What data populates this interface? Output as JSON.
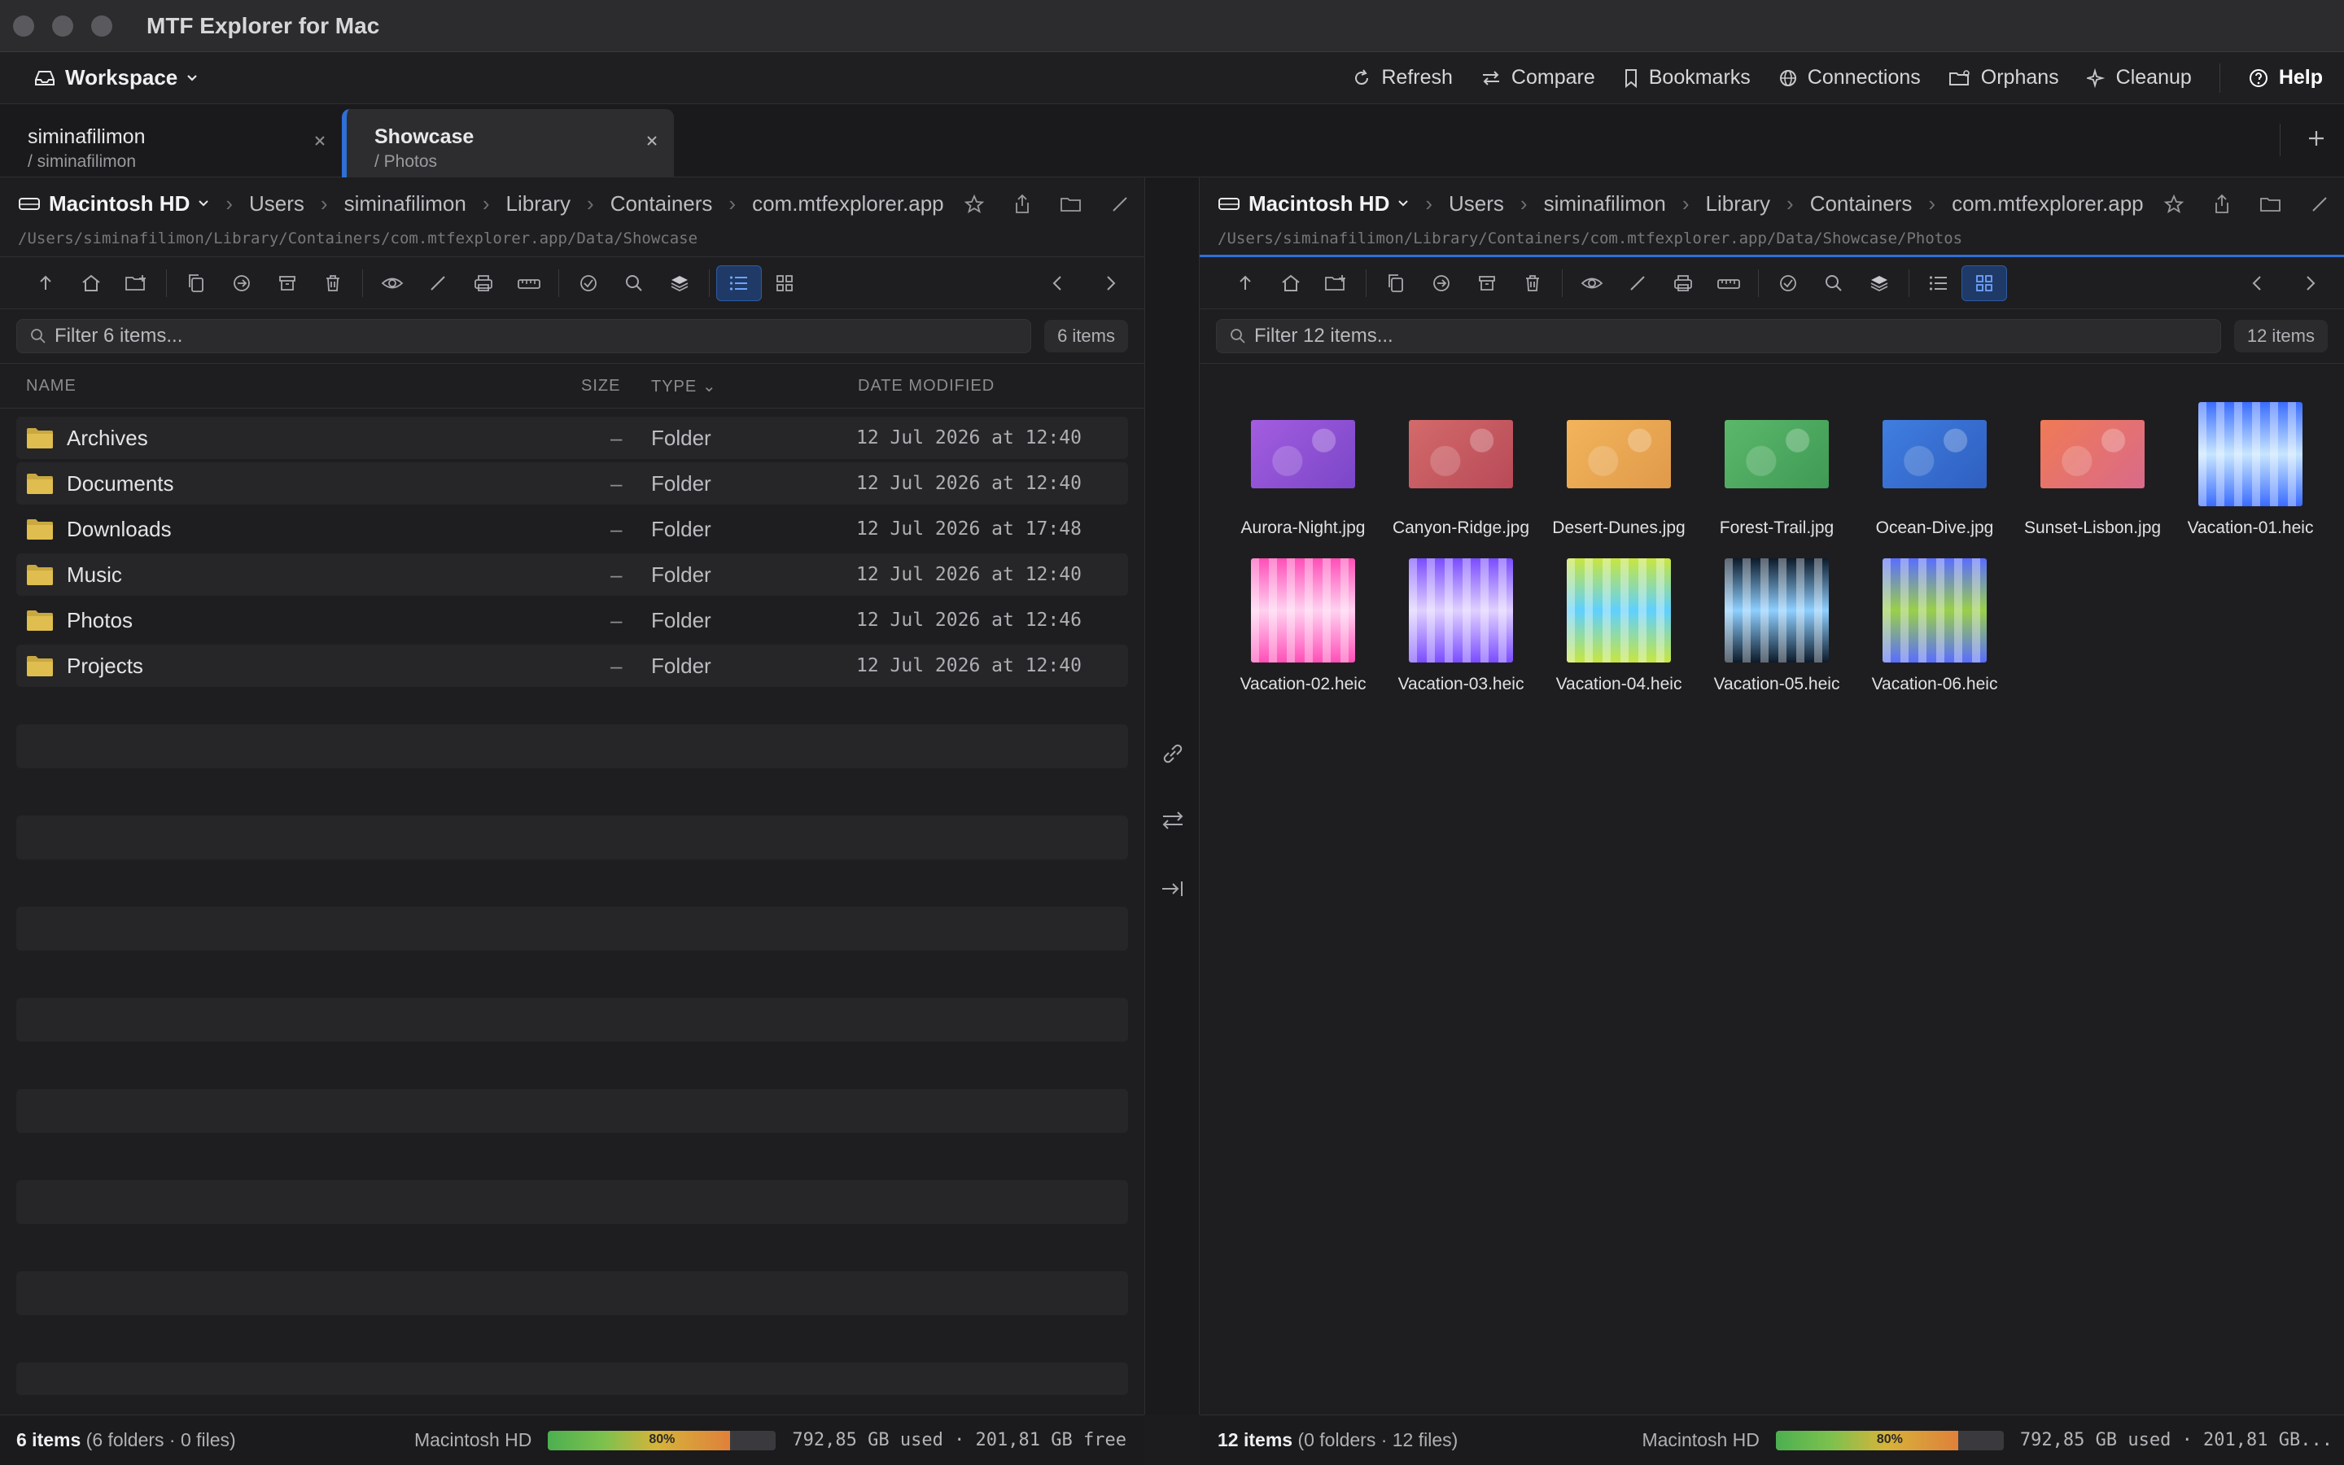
{
  "app": {
    "title": "MTF Explorer for Mac"
  },
  "workspace": {
    "label": "Workspace",
    "actions": [
      {
        "label": "Refresh",
        "icon": "refresh-icon"
      },
      {
        "label": "Compare",
        "icon": "compare-icon"
      },
      {
        "label": "Bookmarks",
        "icon": "bookmark-icon"
      },
      {
        "label": "Connections",
        "icon": "globe-icon"
      },
      {
        "label": "Orphans",
        "icon": "folder-orphan-icon"
      },
      {
        "label": "Cleanup",
        "icon": "sparkle-icon"
      }
    ],
    "help": "Help"
  },
  "tabs": [
    {
      "name": "siminafilimon",
      "path": "/ siminafilimon"
    },
    {
      "name": "Showcase",
      "path": "/ Photos"
    }
  ],
  "left": {
    "disk": "Macintosh HD",
    "crumbs": [
      "Users",
      "siminafilimon",
      "Library",
      "Containers",
      "com.mtfexplorer.app"
    ],
    "path": "/Users/siminafilimon/Library/Containers/com.mtfexplorer.app/Data/Showcase",
    "filter_placeholder": "Filter 6 items...",
    "count": "6 items",
    "columns": {
      "name": "NAME",
      "size": "SIZE",
      "type": "TYPE",
      "date": "DATE MODIFIED"
    },
    "rows": [
      {
        "name": "Archives",
        "size": "–",
        "type": "Folder",
        "date": "12 Jul 2026 at 12:40"
      },
      {
        "name": "Documents",
        "size": "–",
        "type": "Folder",
        "date": "12 Jul 2026 at 12:40"
      },
      {
        "name": "Downloads",
        "size": "–",
        "type": "Folder",
        "date": "12 Jul 2026 at 17:48"
      },
      {
        "name": "Music",
        "size": "–",
        "type": "Folder",
        "date": "12 Jul 2026 at 12:40"
      },
      {
        "name": "Photos",
        "size": "–",
        "type": "Folder",
        "date": "12 Jul 2026 at 12:46"
      },
      {
        "name": "Projects",
        "size": "–",
        "type": "Folder",
        "date": "12 Jul 2026 at 12:40"
      }
    ],
    "status": {
      "items": "6 items",
      "detail": "(6 folders · 0 files)",
      "disk": "Macintosh HD",
      "usage_pct": 80,
      "usage_label": "80%",
      "space": "792,85 GB used · 201,81 GB free"
    }
  },
  "right": {
    "disk": "Macintosh HD",
    "crumbs": [
      "Users",
      "siminafilimon",
      "Library",
      "Containers",
      "com.mtfexplorer.app"
    ],
    "path": "/Users/siminafilimon/Library/Containers/com.mtfexplorer.app/Data/Showcase/Photos",
    "filter_placeholder": "Filter 12 items...",
    "count": "12 items",
    "files": [
      {
        "name": "Aurora-Night.jpg",
        "colors": [
          "#a35de0",
          "#7b46c8"
        ],
        "shape": "landscape"
      },
      {
        "name": "Canyon-Ridge.jpg",
        "colors": [
          "#d36a6a",
          "#b84a58"
        ],
        "shape": "landscape"
      },
      {
        "name": "Desert-Dunes.jpg",
        "colors": [
          "#f2b45b",
          "#e09a4a"
        ],
        "shape": "landscape"
      },
      {
        "name": "Forest-Trail.jpg",
        "colors": [
          "#5bb86a",
          "#3f9a55"
        ],
        "shape": "landscape"
      },
      {
        "name": "Ocean-Dive.jpg",
        "colors": [
          "#3f7ee0",
          "#2f5fc0"
        ],
        "shape": "landscape"
      },
      {
        "name": "Sunset-Lisbon.jpg",
        "colors": [
          "#f07a55",
          "#d96a8a"
        ],
        "shape": "landscape"
      },
      {
        "name": "Vacation-01.heic",
        "colors": [
          "#3a6cff",
          "#c8e6ff"
        ],
        "shape": "square"
      },
      {
        "name": "Vacation-02.heic",
        "colors": [
          "#ff4fb8",
          "#ffd1f0"
        ],
        "shape": "square"
      },
      {
        "name": "Vacation-03.heic",
        "colors": [
          "#7a4dff",
          "#e0d0ff"
        ],
        "shape": "square"
      },
      {
        "name": "Vacation-04.heic",
        "colors": [
          "#c8e640",
          "#5fd0ff"
        ],
        "shape": "square"
      },
      {
        "name": "Vacation-05.heic",
        "colors": [
          "#0c1a2a",
          "#8fcfff"
        ],
        "shape": "square"
      },
      {
        "name": "Vacation-06.heic",
        "colors": [
          "#5a6dff",
          "#9ad04a"
        ],
        "shape": "square"
      }
    ],
    "status": {
      "items": "12 items",
      "detail": "(0 folders · 12 files)",
      "disk": "Macintosh HD",
      "usage_pct": 80,
      "usage_label": "80%",
      "space": "792,85 GB used · 201,81 GB..."
    }
  }
}
